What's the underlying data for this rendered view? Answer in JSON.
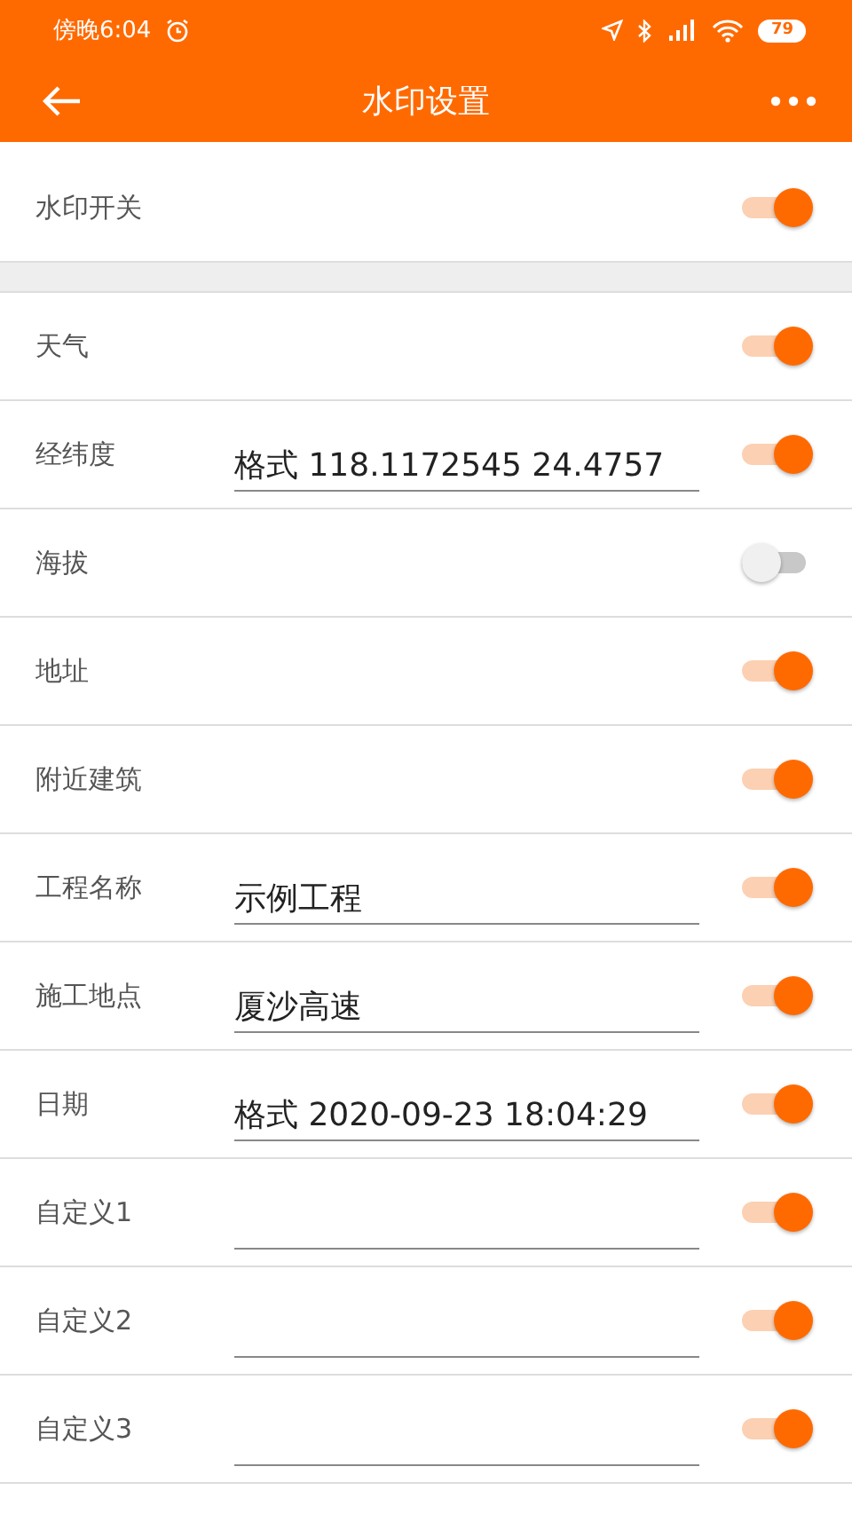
{
  "status_bar": {
    "time": "傍晚6:04",
    "battery": "79"
  },
  "header": {
    "title": "水印设置"
  },
  "master": {
    "label": "水印开关",
    "on": true
  },
  "rows": [
    {
      "kind": "switch",
      "label": "天气",
      "on": true
    },
    {
      "kind": "field",
      "label": "经纬度",
      "value": "格式 118.1172545 24.4757",
      "on": true
    },
    {
      "kind": "switch",
      "label": "海拔",
      "on": false
    },
    {
      "kind": "switch",
      "label": "地址",
      "on": true
    },
    {
      "kind": "switch",
      "label": "附近建筑",
      "on": true
    },
    {
      "kind": "field",
      "label": "工程名称",
      "value": "示例工程",
      "on": true
    },
    {
      "kind": "field",
      "label": "施工地点",
      "value": "厦沙高速",
      "on": true
    },
    {
      "kind": "field",
      "label": "日期",
      "value": "格式 2020-09-23 18:04:29",
      "on": true
    },
    {
      "kind": "field",
      "label": "自定义1",
      "on": true
    },
    {
      "kind": "field",
      "label": "自定义2",
      "on": true
    },
    {
      "kind": "field",
      "label": "自定义3",
      "on": true
    }
  ]
}
